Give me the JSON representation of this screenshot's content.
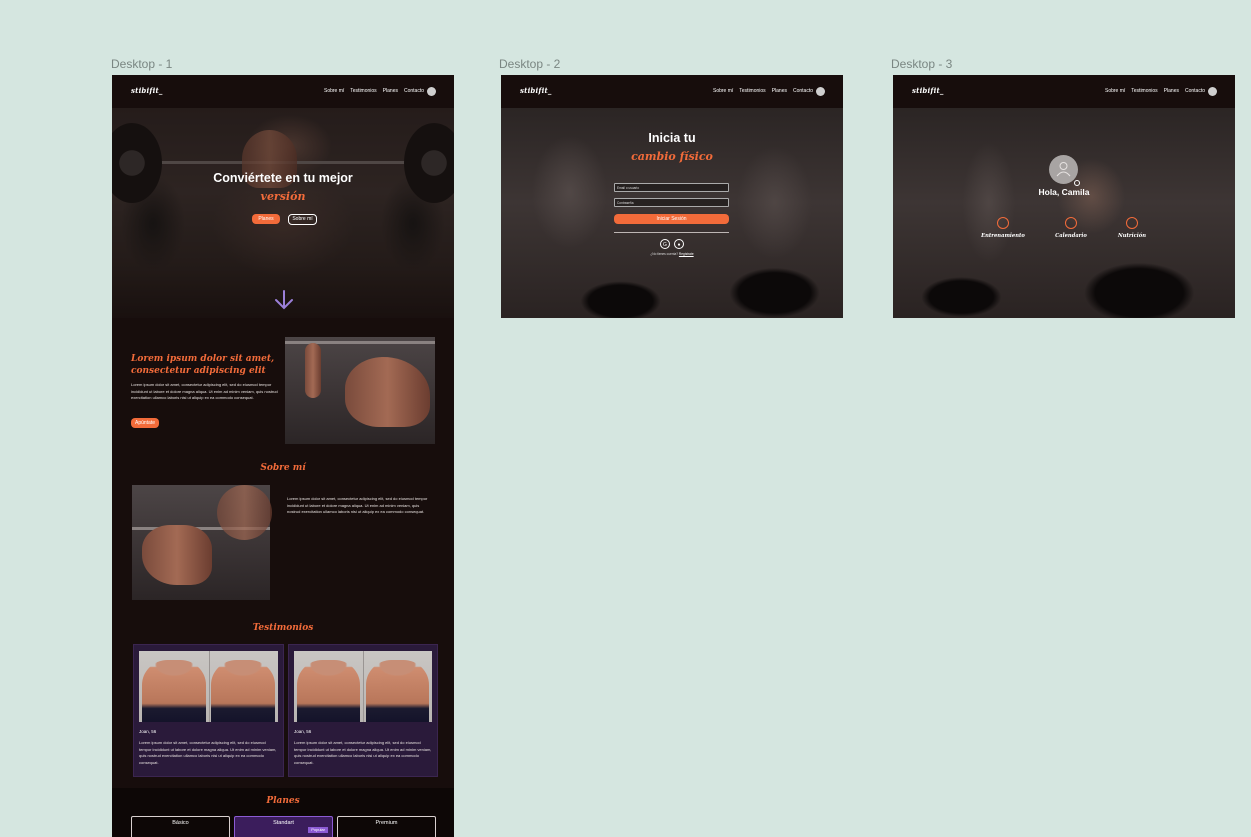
{
  "frames": {
    "d1": "Desktop - 1",
    "d2": "Desktop - 2",
    "d3": "Desktop - 3"
  },
  "brand": {
    "logo": "stibifit_",
    "accent_color": "#f26b3a",
    "background_color": "#170d0c",
    "card_color": "#2a1a3a"
  },
  "nav": {
    "links": [
      "Sobre mí",
      "Testimonios",
      "Planes",
      "Contacto"
    ]
  },
  "desktop1": {
    "hero": {
      "title": "Conviértete en tu mejor",
      "accent": "versión",
      "btn_primary": "Planes",
      "btn_secondary": "Sobre mí",
      "arrow_icon": "arrow-down-icon"
    },
    "intro": {
      "heading_line1": "Lorem ipsum dolor sit amet,",
      "heading_line2": "consectetur adipiscing elit",
      "body": "Lorem ipsum dolor sit amet, consectetur adipiscing elit, sed do eiusmod tempor incididunt ut labore et dolore magna aliqua. Ut enim ad minim veniam, quis nostrud exercitation ullamco laboris nisi ut aliquip ex ea commodo consequat.",
      "button": "Apúntate"
    },
    "about": {
      "title": "Sobre mí",
      "body": "Lorem ipsum dolor sit amet, consectetur adipiscing elit, sed do eiusmod tempor incididunt ut labore et dolore magna aliqua. Ut enim ad minim veniam, quis nostrud exercitation ullamco laboris nisi ut aliquip ex ea commodo consequat."
    },
    "testimonials": {
      "title": "Testimonios",
      "items": [
        {
          "name": "Joan, 56",
          "text": "Lorem ipsum dolor sit amet, consectetur adipiscing elit, sed do eiusmod tempor incididunt ut labore et dolore magna aliqua. Ut enim ad minim veniam, quis nostrud exercitation ullamco laboris nisi ut aliquip ex ea commodo consequat."
        },
        {
          "name": "Joan, 56",
          "text": "Lorem ipsum dolor sit amet, consectetur adipiscing elit, sed do eiusmod tempor incididunt ut labore et dolore magna aliqua. Ut enim ad minim veniam, quis nostrud exercitation ullamco laboris nisi ut aliquip ex ea commodo consequat."
        }
      ]
    },
    "plans": {
      "title": "Planes",
      "items": [
        "Básico",
        "Standart",
        "Premium"
      ],
      "popular_badge": "Popular"
    }
  },
  "desktop2": {
    "title": "Inicia tu",
    "accent": "cambio físico",
    "email_placeholder": "Email o usuario",
    "password_placeholder": "Contraseña",
    "login_button": "Iniciar Sesión",
    "social_icons": [
      "google-icon",
      "apple-icon"
    ],
    "no_account": "¿No tienes cuenta?",
    "register": "Regístrate"
  },
  "desktop3": {
    "greeting": "Hola, Camila",
    "features": [
      "Entrenamiento",
      "Calendario",
      "Nutrición"
    ]
  }
}
